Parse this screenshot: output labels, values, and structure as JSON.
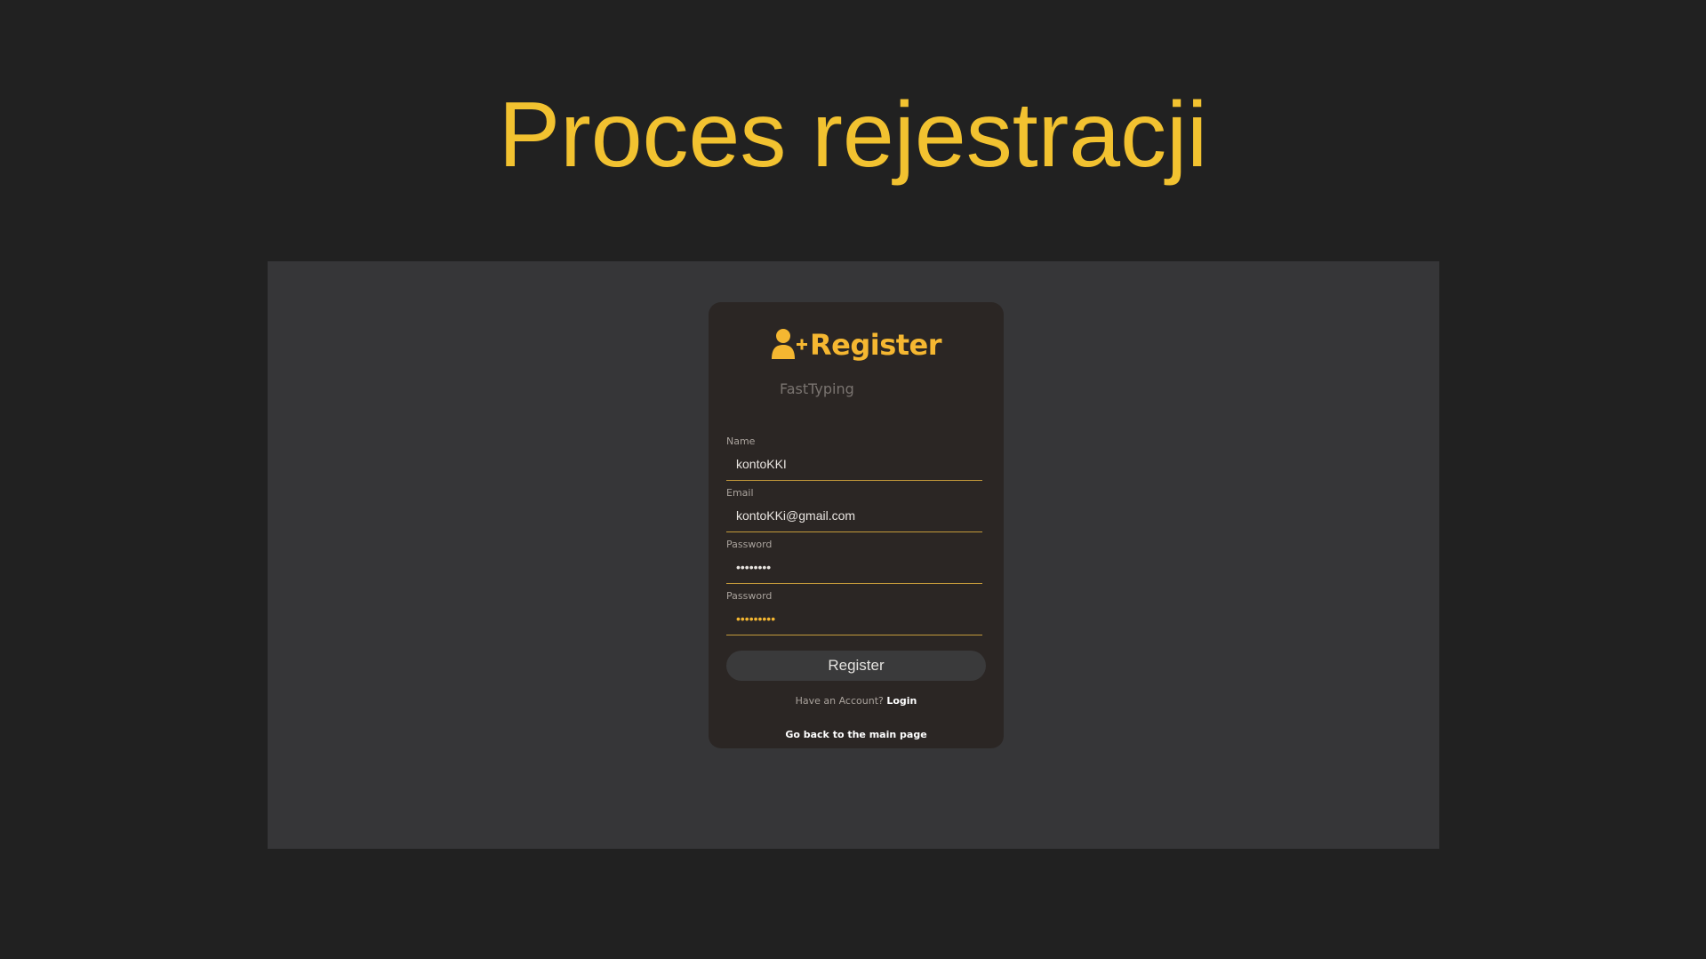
{
  "slide": {
    "title": "Proces rejestracji"
  },
  "card": {
    "title": "Register",
    "brand": "FastTyping",
    "icon": "user-plus-icon",
    "accent_color": "#f5b731"
  },
  "form": {
    "fields": [
      {
        "label": "Name",
        "value": "kontoKKI",
        "type": "text"
      },
      {
        "label": "Email",
        "value": "kontoKKi@gmail.com",
        "type": "email"
      },
      {
        "label": "Password",
        "value": "••••••••",
        "type": "password"
      },
      {
        "label": "Password",
        "value": "•••••••••",
        "type": "password"
      }
    ],
    "submit_label": "Register"
  },
  "footer": {
    "have_account_text": "Have an Account?",
    "login_label": "Login",
    "back_label": "Go back to the main page"
  }
}
